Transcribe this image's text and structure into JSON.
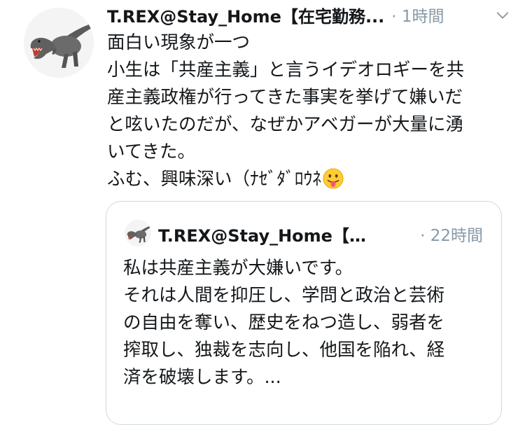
{
  "tweet": {
    "display_name": "T.REX@Stay_Home【在宅勤務...",
    "time": "· 1時間",
    "lines": [
      "面白い現象が一つ",
      "小生は「共産主義」と言うイデオロギーを共",
      "産主義政権が行ってきた事実を挙げて嫌いだ",
      "と呟いたのだが、なぜかアベガーが大量に湧",
      "いてきた。",
      "ふむ、興味深い（ﾅｾﾞﾀﾞﾛｳﾈ"
    ],
    "emoji": "face-with-tongue-icon"
  },
  "quote": {
    "display_name": "T.REX@Stay_Home【…",
    "time": "· 22時間",
    "lines": [
      "私は共産主義が大嫌いです。",
      "それは人間を抑圧し、学問と政治と芸術",
      "の自由を奪い、歴史をねつ造し、弱者を",
      "搾取し、独裁を志向し、他国を陥れ、経",
      "済を破壊します。..."
    ]
  },
  "colors": {
    "text": "#14171a",
    "secondary": "#8899a6",
    "border": "#cfd9de"
  }
}
